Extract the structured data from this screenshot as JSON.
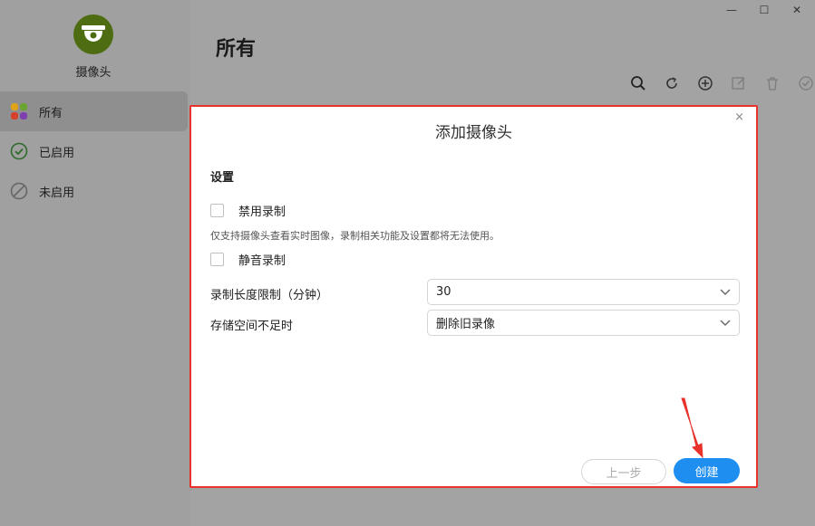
{
  "window": {
    "controls": [
      "—",
      "☐",
      "✕"
    ]
  },
  "sidebar": {
    "app_name": "摄像头",
    "items": [
      {
        "label": "所有",
        "active": true
      },
      {
        "label": "已启用",
        "active": false
      },
      {
        "label": "未启用",
        "active": false
      }
    ]
  },
  "main": {
    "title": "所有",
    "toolbar_icons": [
      "search-icon",
      "refresh-icon",
      "add-icon",
      "edit-icon",
      "delete-icon",
      "enable-icon"
    ]
  },
  "dialog": {
    "title": "添加摄像头",
    "close": "×",
    "section_title": "设置",
    "disable_recording": {
      "label": "禁用录制",
      "checked": false
    },
    "hint": "仅支持摄像头查看实时图像，录制相关功能及设置都将无法使用。",
    "mute_recording": {
      "label": "静音录制",
      "checked": false
    },
    "recording_limit": {
      "label": "录制长度限制（分钟）",
      "value": "30"
    },
    "storage_full": {
      "label": "存储空间不足时",
      "value": "删除旧录像"
    },
    "prev_button": "上一步",
    "create_button": "创建"
  },
  "colors": {
    "accent": "#1e8ff0",
    "highlight_border": "#e8322b",
    "app_icon_bg": "#4e6d12"
  }
}
